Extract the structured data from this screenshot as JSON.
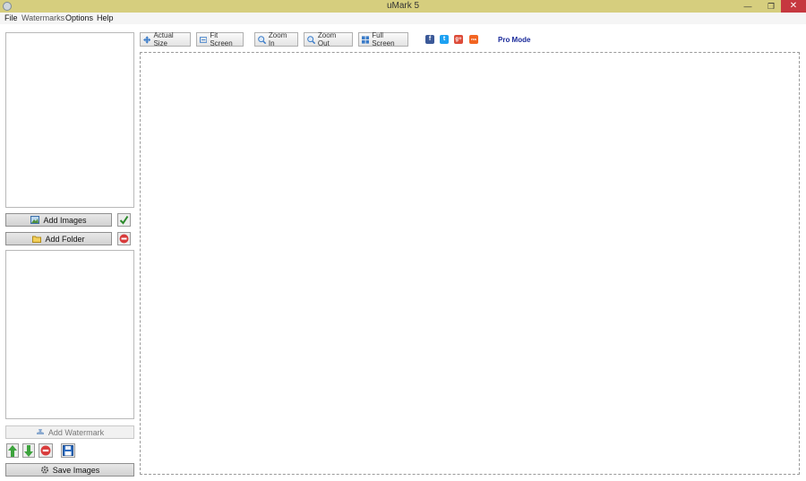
{
  "window": {
    "title": "uMark 5",
    "minimize_glyph": "—",
    "maximize_glyph": "❐",
    "close_glyph": "✕"
  },
  "menu": [
    "File",
    "Watermarks",
    "Options",
    "Help"
  ],
  "left_panel": {
    "add_images_label": "Add Images",
    "add_folder_label": "Add Folder",
    "add_watermark_label": "Add Watermark",
    "save_images_label": "Save Images"
  },
  "toolbar": {
    "actual_size": "Actual Size",
    "fit_screen": "Fit Screen",
    "zoom_in": "Zoom In",
    "zoom_out": "Zoom Out",
    "full_screen": "Full Screen",
    "pro_mode": "Pro Mode"
  },
  "social": {
    "facebook": "f",
    "twitter": "t",
    "googleplus": "g+",
    "rss": "rss"
  },
  "icons": {
    "app": "umark-logo-icon",
    "add_images": "image-add-icon",
    "add_folder": "folder-add-icon",
    "select_all": "checkmark-icon",
    "remove": "remove-icon",
    "add_watermark": "stamp-icon",
    "move_up": "arrow-up-icon",
    "move_down": "arrow-down-icon",
    "delete_watermark": "remove-icon",
    "save_settings": "floppy-disk-icon",
    "save_images": "gear-icon"
  },
  "colors": {
    "titlebar": "#d6ce7e",
    "close_button": "#c6383f",
    "pro_mode": "#1a2a9a",
    "facebook": "#3b5998",
    "twitter": "#1da1f2",
    "googleplus": "#dd4b39",
    "rss": "#f26522"
  }
}
